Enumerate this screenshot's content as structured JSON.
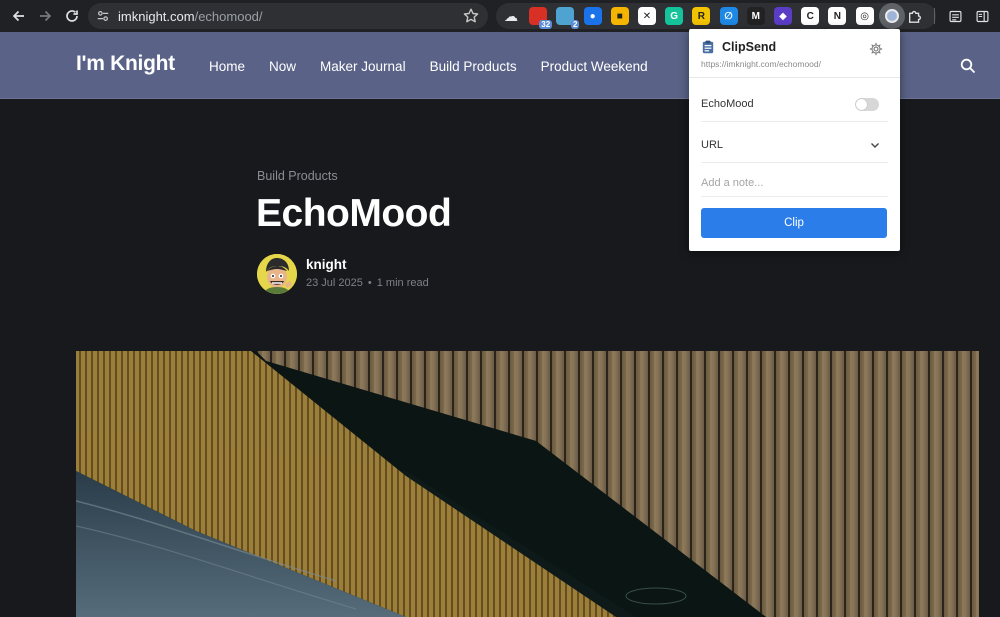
{
  "browser": {
    "url_host": "imknight.com",
    "url_path": "/echomood/",
    "extensions": [
      {
        "name": "cloud-extension-icon",
        "glyph": "☁",
        "bg": "transparent"
      },
      {
        "name": "calendar-extension-icon",
        "glyph": "",
        "badge": "32",
        "bg": "#d93025"
      },
      {
        "name": "pin-extension-icon",
        "glyph": "",
        "badge": "2",
        "bg": "#4fa3d1"
      },
      {
        "name": "password-extension-icon",
        "glyph": "●",
        "bg": "#1a73e8"
      },
      {
        "name": "yellow-extension-icon",
        "glyph": "■",
        "bg": "#f4b400"
      },
      {
        "name": "x-extension-icon",
        "glyph": "✕",
        "bg": "#ffffff"
      },
      {
        "name": "grammarly-extension-icon",
        "glyph": "G",
        "bg": "#15c39a"
      },
      {
        "name": "r-extension-icon",
        "glyph": "R",
        "bg": "#f2c300"
      },
      {
        "name": "link-extension-icon",
        "glyph": "∅",
        "bg": "#1e88e5"
      },
      {
        "name": "m-extension-icon",
        "glyph": "M",
        "bg": "#222222"
      },
      {
        "name": "purple-extension-icon",
        "glyph": "◆",
        "bg": "#5b3cc4"
      },
      {
        "name": "c-extension-icon",
        "glyph": "C",
        "bg": "#ffffff"
      },
      {
        "name": "notion-extension-icon",
        "glyph": "N",
        "bg": "#ffffff"
      },
      {
        "name": "camera-extension-icon",
        "glyph": "◎",
        "bg": "#ffffff"
      },
      {
        "name": "clipsend-extension-icon",
        "glyph": "●",
        "bg": "#9fb4d6"
      }
    ]
  },
  "site": {
    "logo": "I'm Knight",
    "nav": [
      "Home",
      "Now",
      "Maker Journal",
      "Build Products",
      "Product Weekend"
    ]
  },
  "article": {
    "kicker": "Build Products",
    "title": "EchoMood",
    "author": "knight",
    "date": "23 Jul 2025",
    "dot": "•",
    "read_time": "1 min read"
  },
  "popup": {
    "title": "ClipSend",
    "url": "https://imknight.com/echomood/",
    "toggle_label": "EchoMood",
    "toggle_on": false,
    "select_value": "URL",
    "note_placeholder": "Add a note...",
    "clip_label": "Clip"
  },
  "colors": {
    "header_bg": "#5a6387",
    "page_bg": "#18191d",
    "clip_button": "#2b7de9"
  }
}
